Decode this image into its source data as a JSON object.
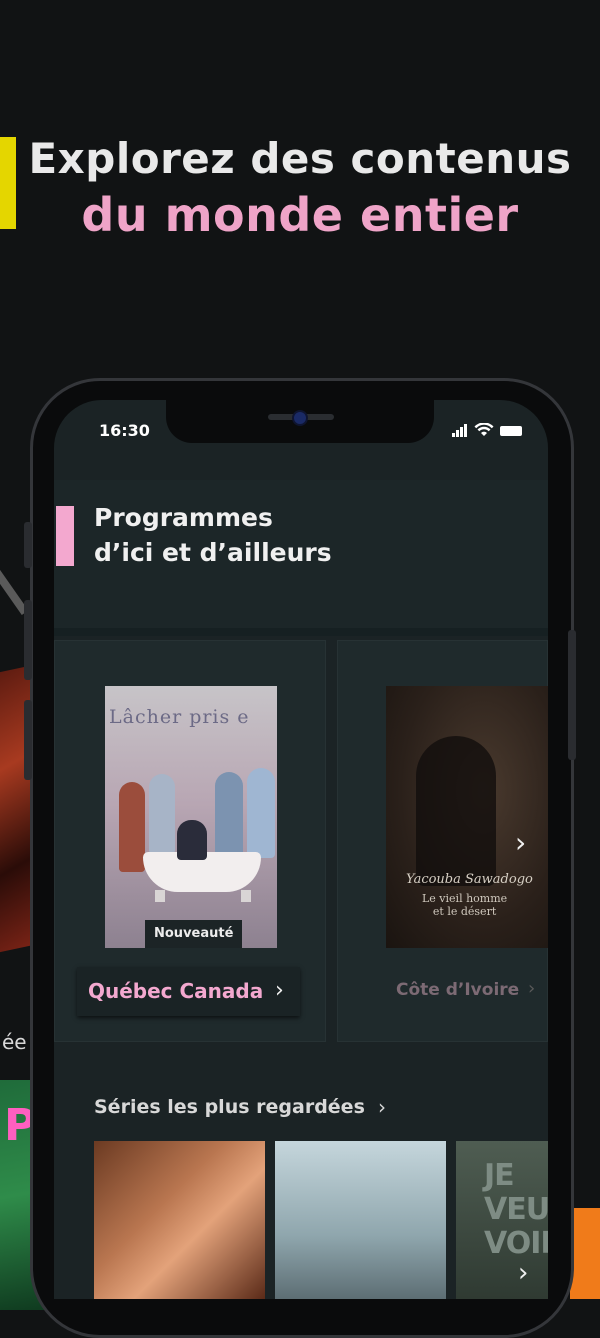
{
  "headline": {
    "line1": "Explorez des contenus",
    "line2": "du monde entier"
  },
  "colors": {
    "accent_pink": "#f3a8cf",
    "accent_yellow": "#e4d600",
    "accent_orange": "#f07b1a",
    "background": "#111314"
  },
  "status_bar": {
    "time": "16:30",
    "icons": [
      "signal-icon",
      "wifi-icon",
      "battery-icon"
    ]
  },
  "section": {
    "title_line1": "Programmes",
    "title_line2": "d’ici et d’ailleurs"
  },
  "regions": [
    {
      "poster_title": "Lâcher pris e",
      "badge": "Nouveauté",
      "label": "Québec Canada"
    },
    {
      "poster_title": "Yacouba Sawadogo",
      "poster_subtitle_line1": "Le vieil homme",
      "poster_subtitle_line2": "et le désert",
      "label": "Côte d’Ivoire"
    }
  ],
  "series_row": {
    "title": "Séries les plus regardées",
    "thumb3_text": "JE VEUX VOIR"
  },
  "background_partial_text": {
    "side_text": "ée",
    "pink_text": "P"
  }
}
